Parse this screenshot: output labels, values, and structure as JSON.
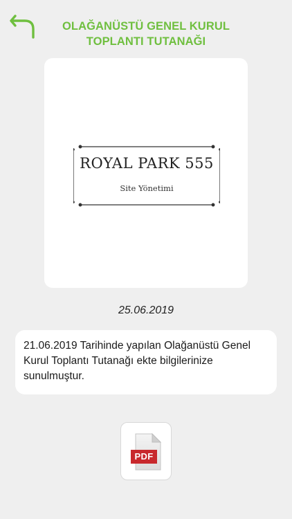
{
  "header": {
    "title_line1": "OLAĞANÜSTÜ GENEL KURUL",
    "title_line2": "TOPLANTI TUTANAĞI",
    "accent_color": "#6fbf3f",
    "back_icon": "back-arrow-icon"
  },
  "logo": {
    "brand": "ROYAL PARK 555",
    "subtitle": "Site Yönetimi"
  },
  "announcement": {
    "date": "25.06.2019",
    "message": "21.06.2019 Tarihinde yapılan Olağanüstü Genel Kurul Toplantı Tutanağı ekte bilgilerinize sunulmuştur."
  },
  "attachment": {
    "label": "PDF",
    "icon": "pdf-file-icon",
    "label_color": "#c8282c"
  }
}
